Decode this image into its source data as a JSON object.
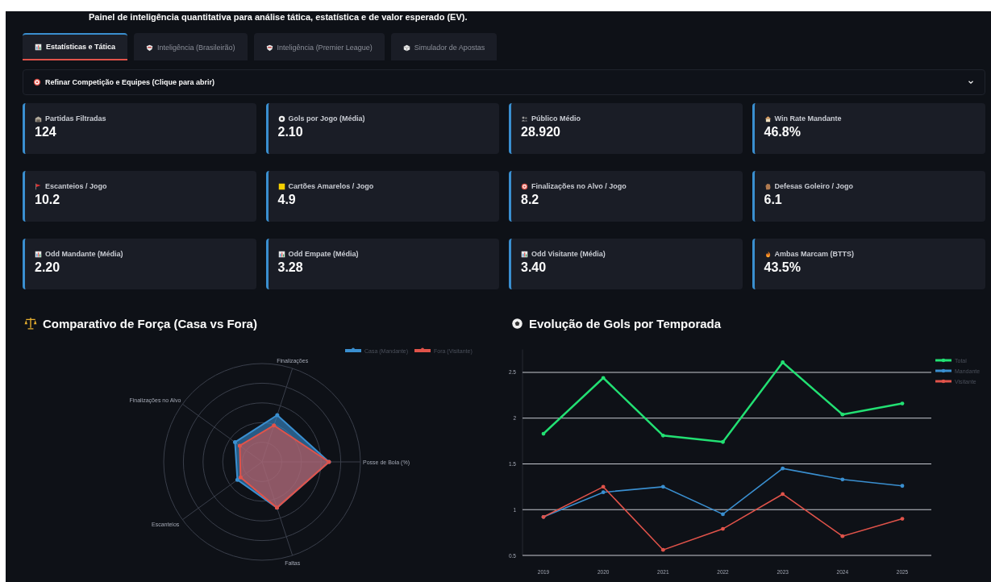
{
  "header": {
    "subtitle": "Painel de inteligência quantitativa para análise tática, estatística e de valor esperado (EV)."
  },
  "tabs": [
    {
      "label": "Estatísticas e Tática",
      "selected": true
    },
    {
      "label": "Inteligência (Brasileirão)",
      "selected": false
    },
    {
      "label": "Inteligência (Premier League)",
      "selected": false
    },
    {
      "label": "Simulador de Apostas",
      "selected": false
    }
  ],
  "filter_panel": {
    "label": "Refinar Competição e Equipes (Clique para abrir)",
    "expanded": false
  },
  "metrics": [
    {
      "label": "Partidas Filtradas",
      "value": "124"
    },
    {
      "label": "Gols por Jogo (Média)",
      "value": "2.10"
    },
    {
      "label": "Público Médio",
      "value": "28.920"
    },
    {
      "label": "Win Rate Mandante",
      "value": "46.8%"
    },
    {
      "label": "Escanteios / Jogo",
      "value": "10.2"
    },
    {
      "label": "Cartões Amarelos / Jogo",
      "value": "4.9"
    },
    {
      "label": "Finalizações no Alvo / Jogo",
      "value": "8.2"
    },
    {
      "label": "Defesas Goleiro / Jogo",
      "value": "6.1"
    },
    {
      "label": "Odd Mandante (Média)",
      "value": "2.20"
    },
    {
      "label": "Odd Empate (Média)",
      "value": "3.28"
    },
    {
      "label": "Odd Visitante (Média)",
      "value": "3.40"
    },
    {
      "label": "Ambas Marcam (BTTS)",
      "value": "43.5%"
    }
  ],
  "strength_comparison": {
    "title": "Comparativo de Força (Casa vs Fora)",
    "legend": [
      {
        "name": "Casa (Mandante)",
        "color": "#3a8fd0"
      },
      {
        "name": "Fora (Visitante)",
        "color": "#e0534a"
      }
    ],
    "axes": [
      "Posse de Bola (%)",
      "Finalizações",
      "Finalizações no Alvo",
      "Escanteios",
      "Faltas"
    ]
  },
  "goals_evolution": {
    "title": "Evolução de Gols por Temporada",
    "chart_data": {
      "type": "line",
      "grid": true,
      "legend": true,
      "ylim": [
        0.5,
        2.75
      ],
      "x": [
        "2019",
        "2020",
        "2021",
        "2022",
        "2023",
        "2024",
        "2025"
      ],
      "yticks": [
        0.5,
        1,
        1.5,
        2,
        2.5
      ],
      "series": [
        {
          "name": "Total",
          "color": "#22e073",
          "values": [
            1.83,
            2.44,
            1.81,
            1.74,
            2.61,
            2.04,
            2.16
          ]
        },
        {
          "name": "Mandante",
          "color": "#3a8fd0",
          "values": [
            0.92,
            1.19,
            1.25,
            0.95,
            1.45,
            1.33,
            1.26
          ]
        },
        {
          "name": "Visitante",
          "color": "#e0534a",
          "values": [
            0.92,
            1.25,
            0.56,
            0.79,
            1.17,
            0.71,
            0.9
          ]
        }
      ]
    }
  }
}
